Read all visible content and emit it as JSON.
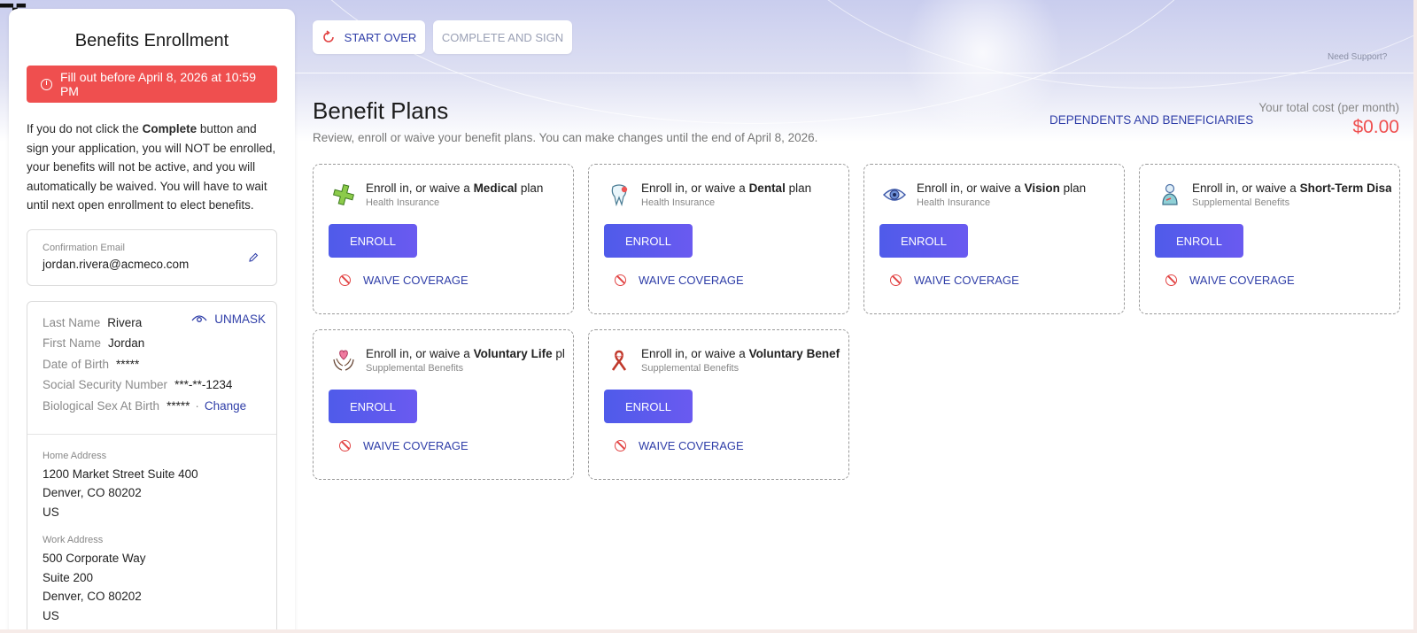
{
  "sidebar": {
    "title": "Benefits Enrollment",
    "deadline": "Fill out before April 8, 2026 at 10:59 PM",
    "notice_pre": "If you do not click the ",
    "notice_bold": "Complete",
    "notice_post": " button and sign your application, you will NOT be enrolled, your benefits will not be active, and you will automatically be waived. You will have to wait until next open enrollment to elect benefits.",
    "email_label": "Confirmation Email",
    "email": "jordan.rivera@acmeco.com",
    "unmask_label": "UNMASK",
    "person": {
      "last_name_label": "Last Name",
      "last_name": "Rivera",
      "first_name_label": "First Name",
      "first_name": "Jordan",
      "dob_label": "Date of Birth",
      "dob": "*****",
      "ssn_label": "Social Security Number",
      "ssn": "***-**-1234",
      "sex_label": "Biological Sex At Birth",
      "sex": "*****",
      "sex_sep": "·",
      "change_label": "Change"
    },
    "home_address": {
      "label": "Home Address",
      "lines": [
        "1200 Market Street Suite 400",
        "Denver, CO 80202",
        "US"
      ]
    },
    "work_address": {
      "label": "Work Address",
      "lines": [
        "500 Corporate Way",
        "Suite 200",
        "Denver, CO 80202",
        "US"
      ]
    }
  },
  "toolbar": {
    "start_over": "START OVER",
    "complete_sign": "COMPLETE AND SIGN",
    "need_support": "Need Support?"
  },
  "main": {
    "title": "Benefit Plans",
    "subtitle": "Review, enroll or waive your benefit plans. You can make changes until the end of April 8, 2026.",
    "dependents_link": "DEPENDENTS AND BENEFICIARIES",
    "cost_label": "Your total cost (per month)",
    "cost_value": "$0.00",
    "plans": [
      {
        "prefix": "Enroll in, or waive a ",
        "name": "Medical",
        "suffix": " plan",
        "category": "Health Insurance",
        "icon": "medical-cross-icon",
        "enroll": "ENROLL",
        "waive": "WAIVE COVERAGE"
      },
      {
        "prefix": "Enroll in, or waive a ",
        "name": "Dental",
        "suffix": " plan",
        "category": "Health Insurance",
        "icon": "tooth-icon",
        "enroll": "ENROLL",
        "waive": "WAIVE COVERAGE"
      },
      {
        "prefix": "Enroll in, or waive a ",
        "name": "Vision",
        "suffix": " plan",
        "category": "Health Insurance",
        "icon": "eye-icon",
        "enroll": "ENROLL",
        "waive": "WAIVE COVERAGE"
      },
      {
        "prefix": "Enroll in, or waive a ",
        "name": "Short-Term Disab",
        "suffix": "",
        "category": "Supplemental Benefits",
        "icon": "person-disability-icon",
        "enroll": "ENROLL",
        "waive": "WAIVE COVERAGE"
      },
      {
        "prefix": "Enroll in, or waive a ",
        "name": "Voluntary Life",
        "suffix": " pla",
        "category": "Supplemental Benefits",
        "icon": "heart-hands-icon",
        "enroll": "ENROLL",
        "waive": "WAIVE COVERAGE"
      },
      {
        "prefix": "Enroll in, or waive a ",
        "name": "Voluntary Benefit",
        "suffix": "",
        "category": "Supplemental Benefits",
        "icon": "ribbon-icon",
        "enroll": "ENROLL",
        "waive": "WAIVE COVERAGE"
      }
    ]
  },
  "colors": {
    "accent": "#2f3ea8",
    "enroll_button": "#4f5bea",
    "deadline_banner": "#ef4f4f",
    "cost": "#ef4f4f"
  }
}
